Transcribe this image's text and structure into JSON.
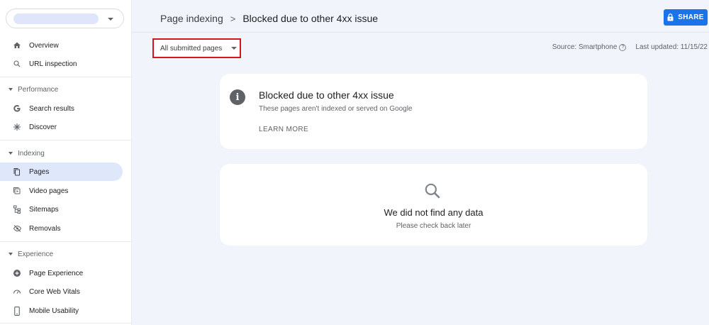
{
  "sidebar": {
    "items": [
      {
        "label": "Overview",
        "icon": "home-icon"
      },
      {
        "label": "URL inspection",
        "icon": "search-icon"
      },
      {
        "label": "Search results",
        "icon": "google-g-icon"
      },
      {
        "label": "Discover",
        "icon": "asterisk-icon"
      },
      {
        "label": "Pages",
        "icon": "pages-icon"
      },
      {
        "label": "Video pages",
        "icon": "video-pages-icon"
      },
      {
        "label": "Sitemaps",
        "icon": "sitemap-icon"
      },
      {
        "label": "Removals",
        "icon": "eye-off-icon"
      },
      {
        "label": "Page Experience",
        "icon": "plus-circle-icon"
      },
      {
        "label": "Core Web Vitals",
        "icon": "gauge-icon"
      },
      {
        "label": "Mobile Usability",
        "icon": "phone-icon"
      }
    ],
    "sections": {
      "performance": "Performance",
      "indexing": "Indexing",
      "experience": "Experience"
    },
    "active": "Pages"
  },
  "header": {
    "breadcrumb_parent": "Page indexing",
    "breadcrumb_separator": ">",
    "breadcrumb_current": "Blocked due to other 4xx issue",
    "share_label": "SHARE"
  },
  "toolbar": {
    "filter_value": "All submitted pages",
    "source_text": "Source: Smartphone",
    "help_glyph": "?",
    "last_updated": "Last updated: 11/15/22"
  },
  "issue_card": {
    "info_glyph": "i",
    "title": "Blocked due to other 4xx issue",
    "subtitle": "These pages aren't indexed or served on Google",
    "learn_more": "LEARN MORE"
  },
  "empty_state": {
    "heading": "We did not find any data",
    "subtext": "Please check back later"
  },
  "colors": {
    "accent": "#1a73e8",
    "highlight_border": "#d6141c",
    "active_nav": "#dfe8fb",
    "background": "#f1f4fa"
  }
}
